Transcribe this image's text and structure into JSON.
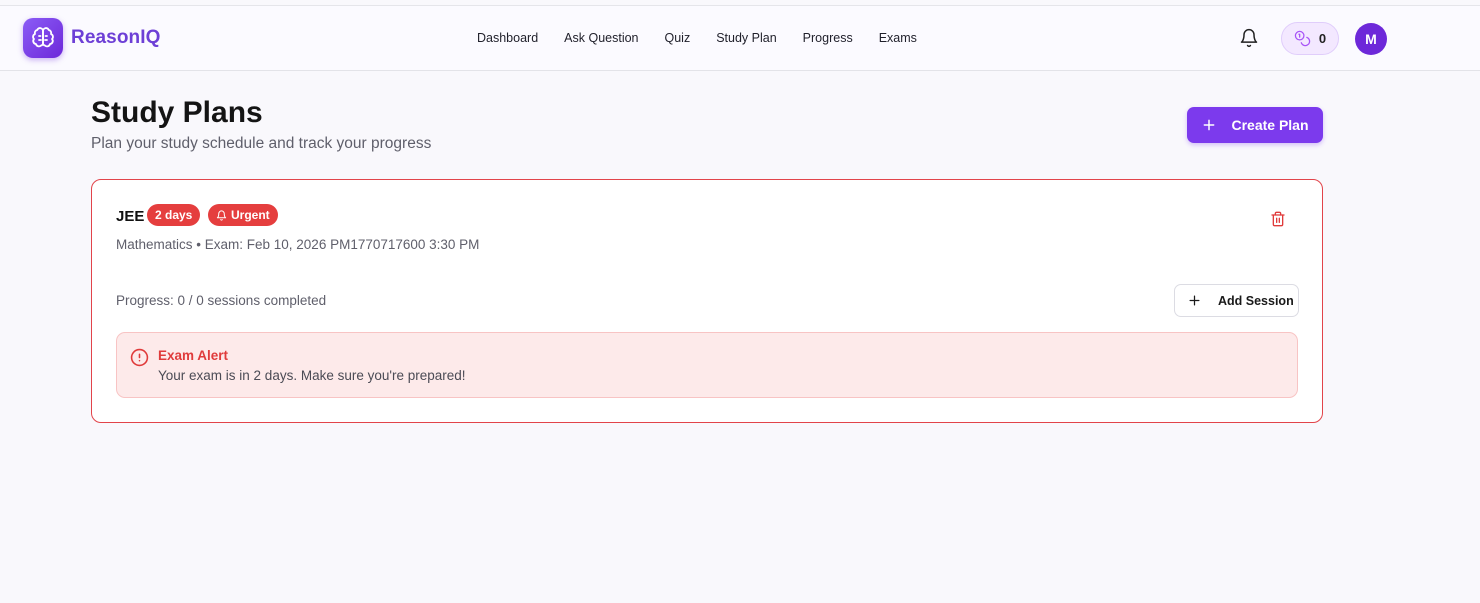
{
  "app": {
    "name": "ReasonIQ",
    "brand_color": "#7c3aed",
    "logo_icon": "brain-icon"
  },
  "nav": {
    "links": [
      {
        "label": "Dashboard"
      },
      {
        "label": "Ask Question"
      },
      {
        "label": "Quiz"
      },
      {
        "label": "Study Plan"
      },
      {
        "label": "Progress"
      },
      {
        "label": "Exams"
      }
    ],
    "notifications_icon": "bell-icon",
    "points_icon": "coins-icon",
    "points": "0",
    "avatar_initial": "M"
  },
  "page": {
    "title": "Study Plans",
    "subtitle": "Plan your study schedule and track your progress",
    "create_button": "Create Plan",
    "create_icon": "plus-icon"
  },
  "plans": [
    {
      "name": "JEE",
      "days_badge": "2 days",
      "urgency_badge": "Urgent",
      "urgency_icon": "bell-icon",
      "meta": "Mathematics • Exam: Feb 10, 2026 PM1770717600 3:30 PM",
      "progress": "Progress: 0 / 0 sessions completed",
      "add_session_label": "Add Session",
      "delete_icon": "trash-icon",
      "alert": {
        "icon": "alert-circle-icon",
        "title": "Exam Alert",
        "text": "Your exam is in 2 days. Make sure you're prepared!"
      },
      "status_color": "#e53e3e"
    }
  ]
}
